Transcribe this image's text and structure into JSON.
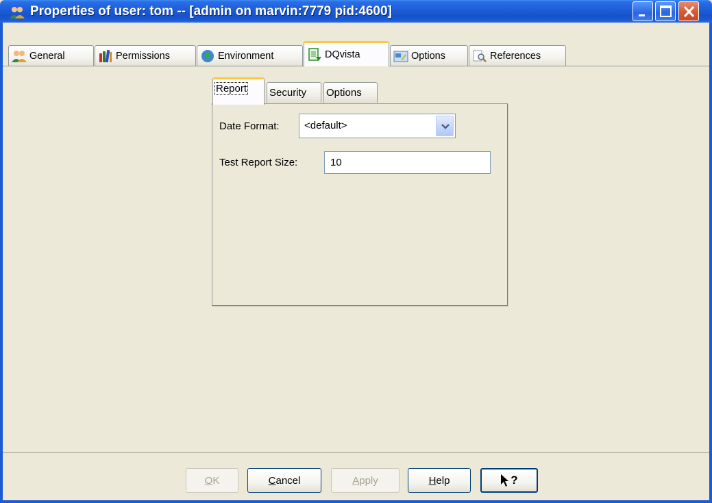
{
  "window": {
    "title": "Properties of user: tom -- [admin on marvin:7779 pid:4600]"
  },
  "tabs": [
    {
      "label": "General",
      "icon": "users-icon"
    },
    {
      "label": "Permissions",
      "icon": "books-icon"
    },
    {
      "label": "Environment",
      "icon": "globe-icon"
    },
    {
      "label": "DQvista",
      "icon": "document-icon",
      "active": true
    },
    {
      "label": "Options",
      "icon": "options-icon"
    },
    {
      "label": "References",
      "icon": "magnifier-icon"
    }
  ],
  "inner_tabs": [
    {
      "label": "Report",
      "active": true
    },
    {
      "label": "Security"
    },
    {
      "label": "Options"
    }
  ],
  "form": {
    "date_format_label": "Date Format:",
    "date_format_value": "<default>",
    "test_report_size_label": "Test Report Size:",
    "test_report_size_value": "10"
  },
  "buttons": {
    "ok": {
      "label": "OK",
      "mnemonic": "O",
      "rest": "K",
      "enabled": false
    },
    "cancel": {
      "label": "Cancel",
      "mnemonic": "C",
      "rest": "ancel",
      "enabled": true
    },
    "apply": {
      "label": "Apply",
      "mnemonic": "A",
      "rest": "pply",
      "enabled": false
    },
    "help": {
      "label": "Help",
      "mnemonic": "H",
      "rest": "elp",
      "enabled": true
    },
    "context_help": {
      "label": "?",
      "icon": "pointer-help-icon"
    }
  },
  "colors": {
    "titlebar": "#1c5ad6",
    "active_tab_accent": "#ffc73d",
    "face": "#ece9d8"
  }
}
